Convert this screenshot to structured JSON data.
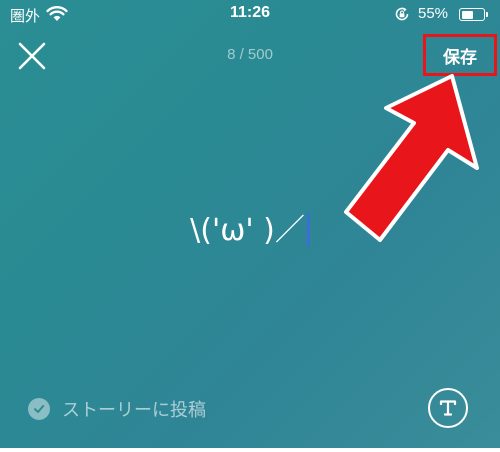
{
  "status_bar": {
    "carrier": "圏外",
    "time": "11:26",
    "battery_percent": "55%",
    "battery_level": 0.55,
    "icons": [
      "wifi-icon",
      "rotation-lock-icon",
      "battery-icon"
    ]
  },
  "header": {
    "close_icon": "close-icon",
    "char_counter": "8 / 500",
    "save_label": "保存"
  },
  "editor": {
    "text": "\\('ω' )／"
  },
  "footer": {
    "post_to_story_label": "ストーリーに投稿",
    "post_to_story_checked": true,
    "check_icon": "check-icon",
    "text_style_icon": "text-style-icon"
  },
  "annotation": {
    "arrow_color": "#e8151b",
    "highlight_color": "#e8151b"
  },
  "colors": {
    "background": "#2b8a93",
    "caret": "#3b6fd6"
  }
}
